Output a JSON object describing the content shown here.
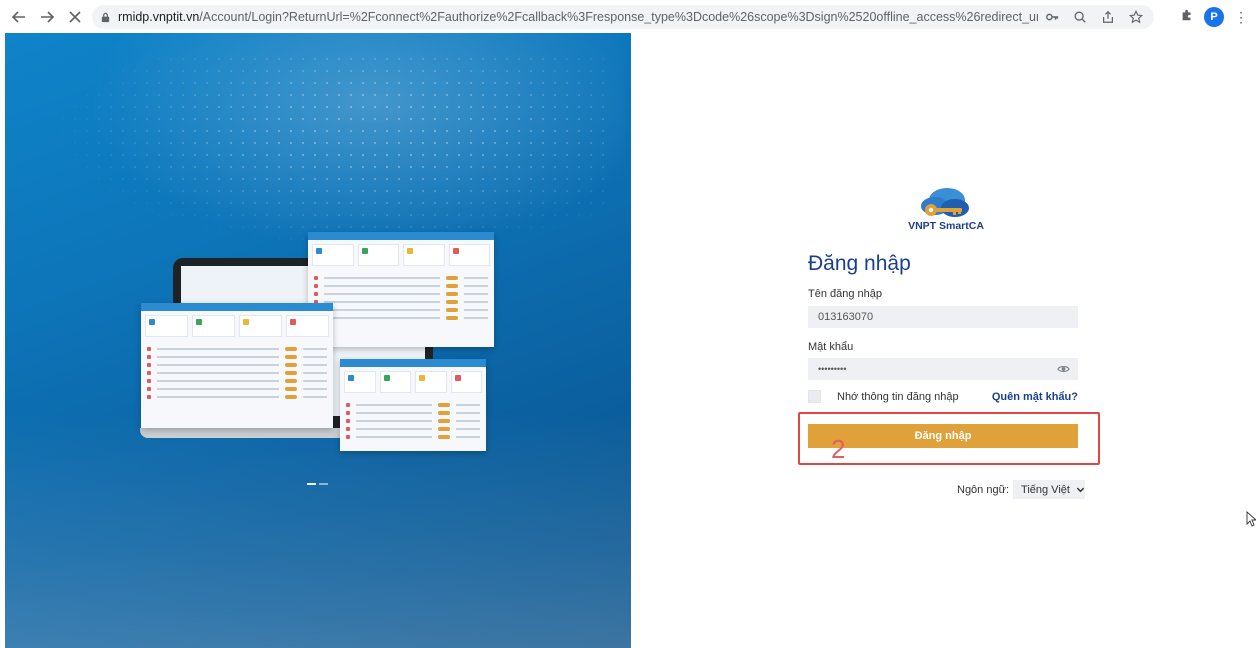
{
  "browser": {
    "url_host": "rmidp.vnptit.vn",
    "url_path": "/Account/Login?ReturnUrl=%2Fconnect%2Fauthorize%2Fcallback%3Fresponse_type%3Dcode%26scope%3Dsign%2520offline_access%26redirect_uri%3Dhttps%253A%252F%252Fte...",
    "profile_initial": "P"
  },
  "login": {
    "brand": "VNPT SmartCA",
    "title": "Đăng nhập",
    "username_label": "Tên đăng nhập",
    "username_value": "013163070",
    "password_label": "Mật khẩu",
    "password_value": "•••••••••",
    "remember_label": "Nhớ thông tin đăng nhập",
    "forgot_label": "Quên mật khẩu?",
    "submit_label": "Đăng nhập",
    "language_label": "Ngôn ngữ:",
    "language_value": "Tiếng Việt"
  },
  "annotation": {
    "step_number": "2"
  },
  "colors": {
    "brand_blue": "#1b3f8f",
    "accent_orange": "#e0a03a",
    "highlight_red": "#e04646"
  }
}
